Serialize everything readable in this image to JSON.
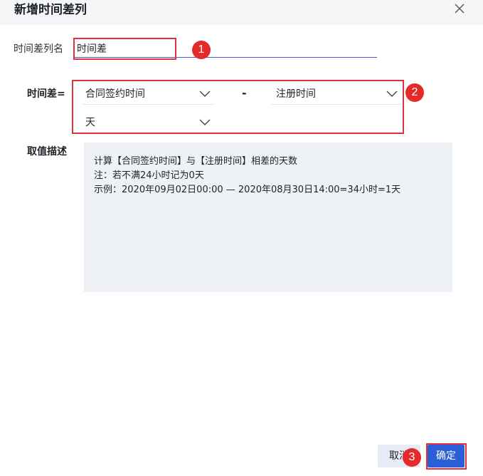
{
  "dialog": {
    "title": "新增时间差列"
  },
  "form": {
    "name_label": "时间差列名",
    "name_value": "时间差",
    "diff_label": "时间差=",
    "start_field": "合同签约时间",
    "separator": "-",
    "end_field": "注册时间",
    "unit": "天",
    "desc_label": "取值描述",
    "description": [
      "计算【合同签约时间】与【注册时间】相差的天数",
      "注：若不满24小时记为0天",
      "示例：2020年09月02日00:00 — 2020年08月30日14:00=34小时=1天"
    ]
  },
  "buttons": {
    "cancel": "取消",
    "ok": "确定"
  },
  "annotations": {
    "badge1": "1",
    "badge2": "2",
    "badge3": "3"
  },
  "colors": {
    "highlight": "#e0303b",
    "badge": "#e52a2a",
    "primary": "#2b5fd9",
    "header_bg": "#f5f6f8",
    "desc_bg": "#eef1f6"
  },
  "icons": {
    "close": "close-icon",
    "dropdown": "chevron-down-icon"
  }
}
